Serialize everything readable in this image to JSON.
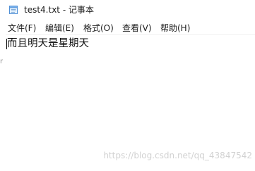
{
  "window": {
    "title": "test4.txt - 记事本",
    "app_icon": "notepad-icon"
  },
  "menu": {
    "items": [
      {
        "label": "文件(F)"
      },
      {
        "label": "编辑(E)"
      },
      {
        "label": "格式(O)"
      },
      {
        "label": "查看(V)"
      },
      {
        "label": "帮助(H)"
      }
    ]
  },
  "editor": {
    "text": "而且明天是星期天"
  },
  "watermark": {
    "text": "https://blog.csdn.net/qq_43847542"
  },
  "clip_mark": {
    "text": "r"
  }
}
